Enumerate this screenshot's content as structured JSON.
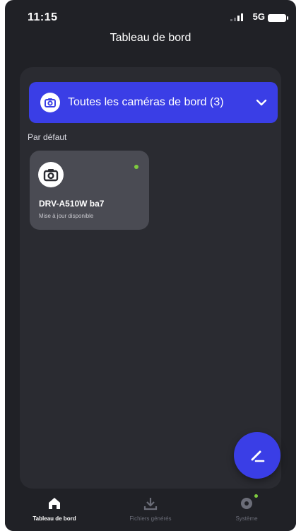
{
  "status_bar": {
    "time": "11:15",
    "network": "5G"
  },
  "header": {
    "title": "Tableau de bord"
  },
  "filter": {
    "label": "Toutes les caméras de bord (3)",
    "icon": "camera-icon"
  },
  "section": {
    "label": "Par défaut"
  },
  "device_card": {
    "name": "DRV-A510W ba7",
    "status": "Mise à jour disponible",
    "icon": "camera-icon"
  },
  "fab": {
    "icon": "edit-icon"
  },
  "tabbar": {
    "items": [
      {
        "label": "Tableau de bord",
        "icon": "home-icon",
        "active": true
      },
      {
        "label": "Fichiers générés",
        "icon": "download-icon",
        "active": false
      },
      {
        "label": "Système",
        "icon": "gear-icon",
        "active": false
      }
    ]
  },
  "colors": {
    "accent": "#3a3ee6",
    "background": "#202126",
    "panel": "#2a2b31",
    "card": "#4a4b53",
    "status_dot": "#7ecb3f"
  }
}
